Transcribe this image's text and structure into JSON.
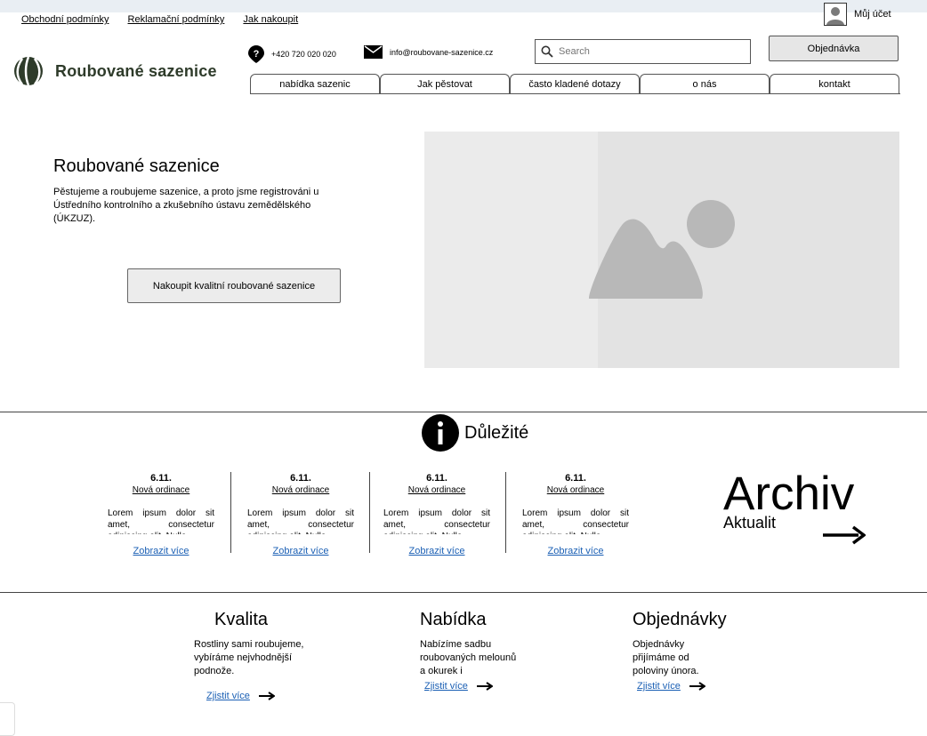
{
  "top_links": [
    "Obchodní podmínky",
    "Reklamační podmínky",
    "Jak nakoupit"
  ],
  "account_label": "Můj účet",
  "logo_text": "Roubované sazenice",
  "contact": {
    "phone": "+420 720 020 020",
    "email": "info@roubovane-sazenice.cz"
  },
  "search": {
    "placeholder": "Search"
  },
  "order_button": "Objednávka",
  "nav": [
    "nabídka sazenic",
    "Jak pěstovat",
    "často kladené dotazy",
    "o nás",
    "kontakt"
  ],
  "hero": {
    "title": "Roubované sazenice",
    "text": "Pěstujeme a roubujeme sazenice, a proto jsme registrováni u Ústředního kontrolního a zkušebního ústavu zemědělského (ÚKZUZ).",
    "button": "Nakoupit kvalitní roubované sazenice"
  },
  "important": {
    "title": "Důležité",
    "news": [
      {
        "date": "6.11.",
        "title": "Nová ordinace",
        "body": "Lorem ipsum dolor sit amet, consectetur adipiscing elit. Nulla",
        "more": "Zobrazit více"
      },
      {
        "date": "6.11.",
        "title": "Nová ordinace",
        "body": "Lorem ipsum dolor sit amet, consectetur adipiscing elit. Nulla",
        "more": "Zobrazit více"
      },
      {
        "date": "6.11.",
        "title": "Nová ordinace",
        "body": "Lorem ipsum dolor sit amet, consectetur adipiscing elit. Nulla",
        "more": "Zobrazit více"
      },
      {
        "date": "6.11.",
        "title": "Nová ordinace",
        "body": "Lorem ipsum dolor sit amet, consectetur adipiscing elit. Nulla",
        "more": "Zobrazit více"
      }
    ],
    "archive": {
      "big": "Archiv",
      "small": "Aktualit"
    }
  },
  "features": [
    {
      "title": "Kvalita",
      "text": "Rostliny sami roubujeme, vybíráme nejvhodnější podnože.",
      "link": "Zjistit více"
    },
    {
      "title": "Nabídka",
      "text": "Nabízíme sadbu roubovaných melounů a okurek i",
      "link": "Zjistit více"
    },
    {
      "title": "Objednávky",
      "text": "Objednávky přijímáme od poloviny února.",
      "link": "Zjistit více"
    }
  ]
}
